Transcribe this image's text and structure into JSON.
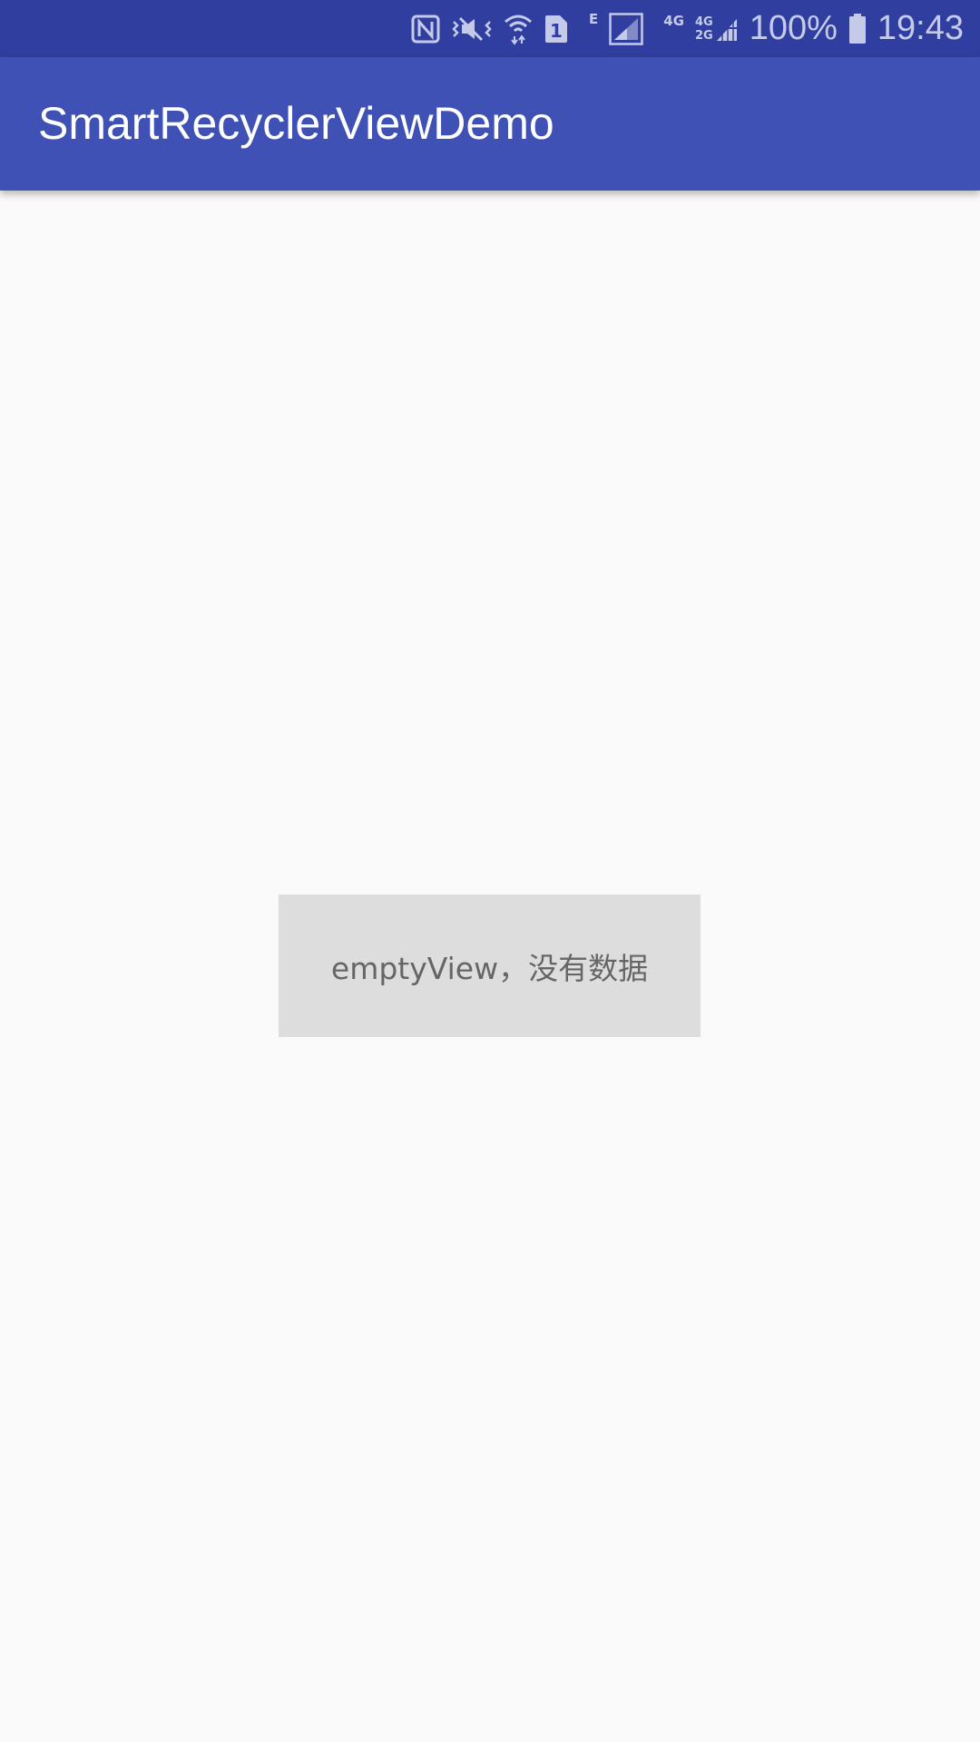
{
  "status_bar": {
    "icons": [
      "nfc-icon",
      "vibrate-icon",
      "wifi-icon",
      "sim1-icon",
      "edge-signal-icon",
      "signal-icon",
      "4g-icon",
      "4g-2g-signal-icon",
      "battery-icon"
    ],
    "edge_label": "E",
    "net1_label": "4G",
    "net2_top": "4G",
    "net2_bottom": "2G",
    "sim_label": "1",
    "battery_percent": "100%",
    "time": "19:43",
    "background": "#303f9f",
    "icon_color": "#c5cae9"
  },
  "app_bar": {
    "title": "SmartRecyclerViewDemo",
    "background": "#3f51b5"
  },
  "empty_view": {
    "text": "emptyView，没有数据",
    "background": "#dddddd",
    "text_color": "#666666"
  }
}
